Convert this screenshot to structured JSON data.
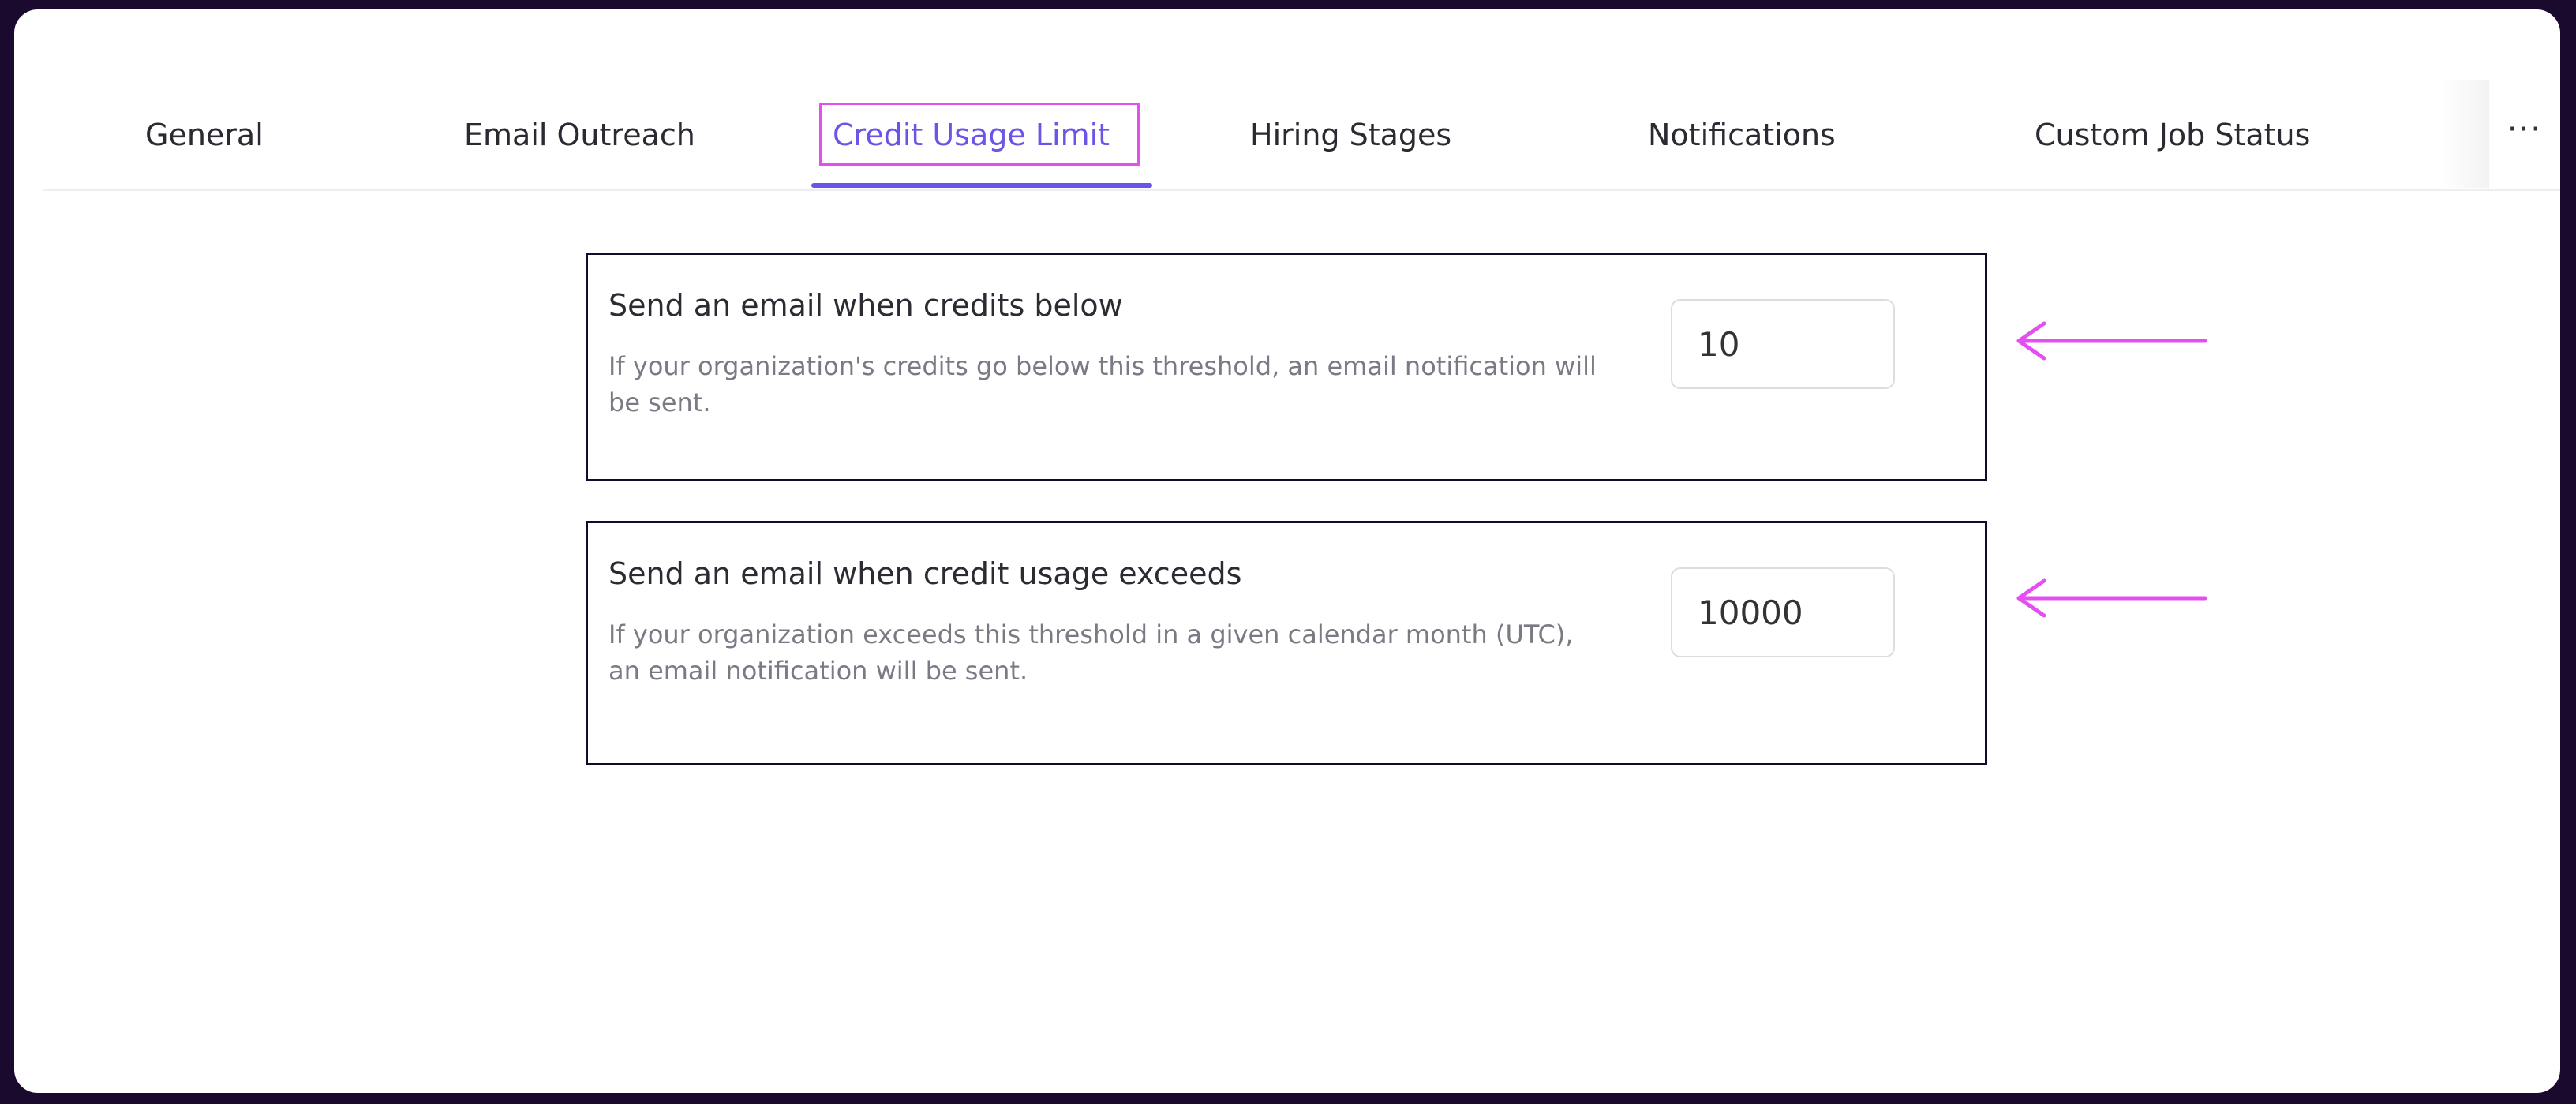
{
  "tabs": [
    {
      "label": "General"
    },
    {
      "label": "Email Outreach"
    },
    {
      "label": "Credit Usage Limit"
    },
    {
      "label": "Hiring Stages"
    },
    {
      "label": "Notifications"
    },
    {
      "label": "Custom Job Status"
    }
  ],
  "active_tab": "Credit Usage Limit",
  "more_label": "···",
  "settings": [
    {
      "title": "Send an email when credits below",
      "description": "If your organization's credits go below this threshold, an email notification will be sent.",
      "value": "10"
    },
    {
      "title": "Send an email when credit usage exceeds",
      "description": "If your organization exceeds this threshold in a given calendar month (UTC), an email notification will be sent.",
      "value": "10000"
    }
  ],
  "colors": {
    "accent": "#6a55e8",
    "highlight": "#e34ff1",
    "frame": "#1a0a2e"
  },
  "icons": {
    "annotation_arrow": "arrow-left-icon",
    "more": "more-horizontal-icon"
  }
}
